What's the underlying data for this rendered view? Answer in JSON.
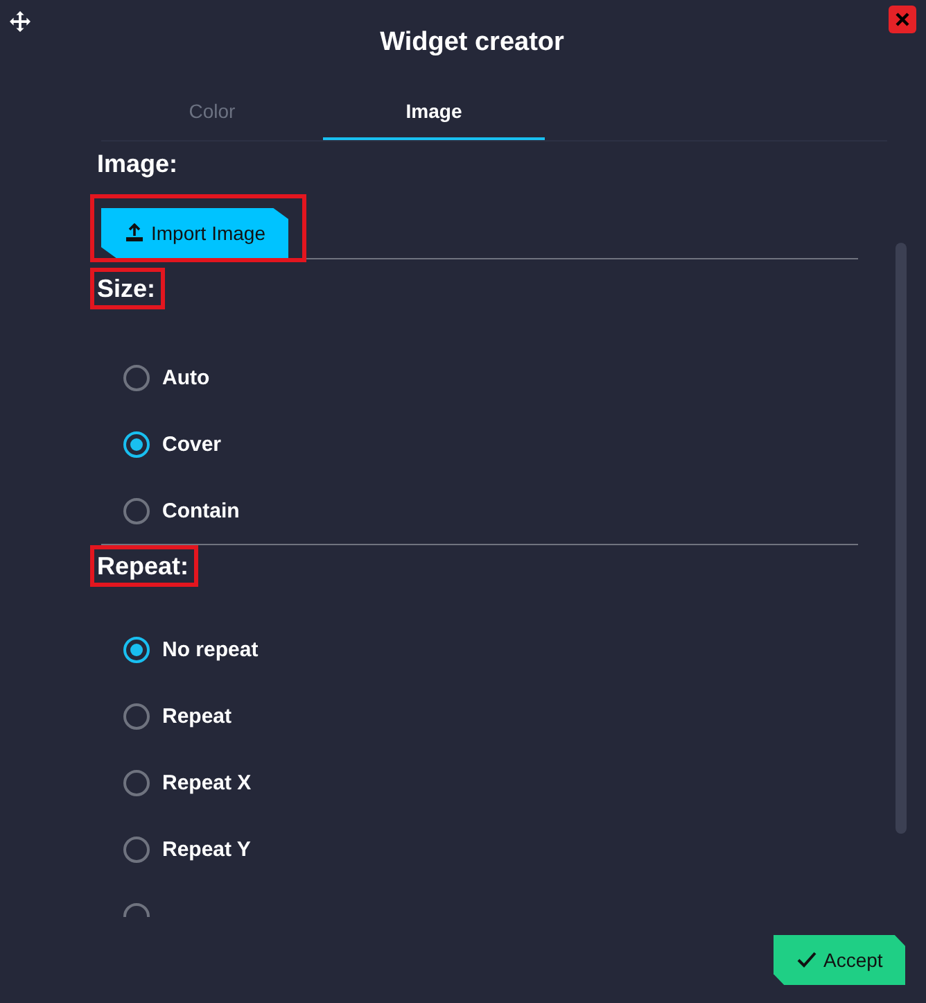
{
  "window": {
    "title": "Widget creator"
  },
  "tabs": [
    {
      "label": "Color",
      "selected": false
    },
    {
      "label": "Image",
      "selected": true
    }
  ],
  "sections": [
    {
      "kind": "button",
      "heading": "Image:",
      "heading_highlighted": false,
      "button": "Import Image",
      "button_highlighted": true
    },
    {
      "kind": "radios",
      "heading": "Size:",
      "heading_highlighted": true,
      "options": [
        {
          "label": "Auto",
          "selected": false
        },
        {
          "label": "Cover",
          "selected": true
        },
        {
          "label": "Contain",
          "selected": false
        }
      ]
    },
    {
      "kind": "radios",
      "heading": "Repeat:",
      "heading_highlighted": true,
      "options": [
        {
          "label": "No repeat",
          "selected": true
        },
        {
          "label": "Repeat",
          "selected": false
        },
        {
          "label": "Repeat X",
          "selected": false
        },
        {
          "label": "Repeat Y",
          "selected": false
        },
        {
          "selected": false
        }
      ]
    }
  ],
  "accept": "Accept"
}
